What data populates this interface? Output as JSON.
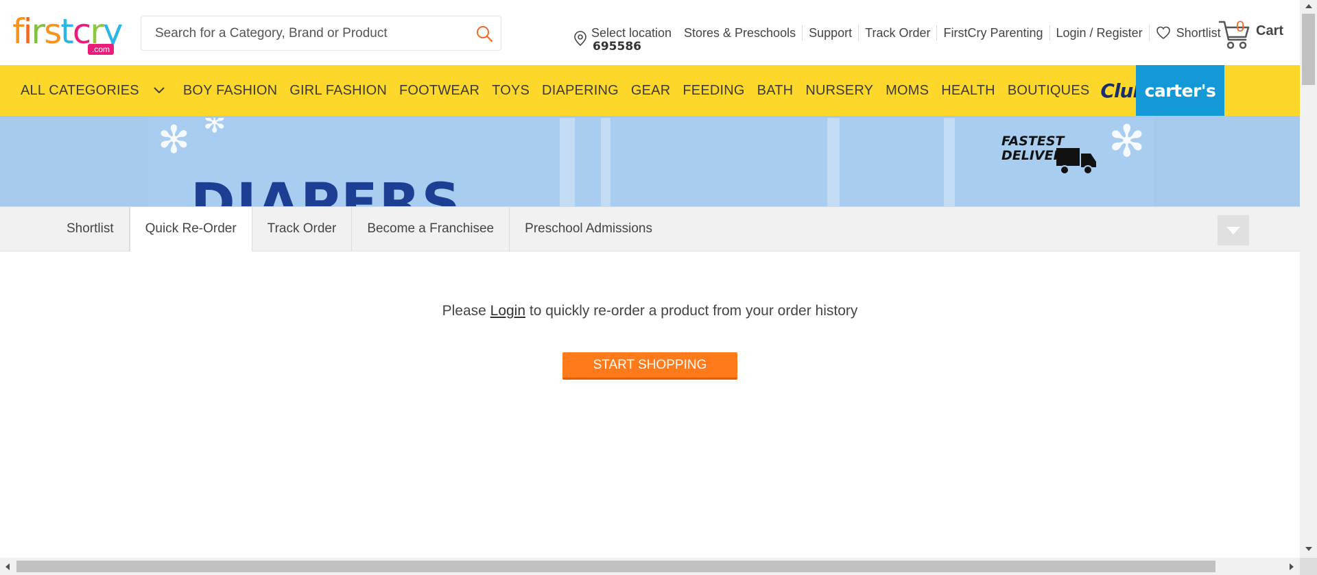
{
  "header": {
    "logo_text": "firstcry",
    "logo_com": ".com",
    "search_placeholder": "Search for a Category, Brand or Product",
    "location": {
      "label": "Select location",
      "pincode": "695586"
    },
    "links": [
      "Stores & Preschools",
      "Support",
      "Track Order",
      "FirstCry Parenting",
      "Login / Register"
    ],
    "shortlist_label": "Shortlist",
    "cart": {
      "count": "0",
      "label": "Cart"
    }
  },
  "nav": {
    "all_categories": "ALL CATEGORIES",
    "items": [
      "BOY FASHION",
      "GIRL FASHION",
      "FOOTWEAR",
      "TOYS",
      "DIAPERING",
      "GEAR",
      "FEEDING",
      "BATH",
      "NURSERY",
      "MOMS",
      "HEALTH",
      "BOUTIQUES"
    ],
    "club": "Club",
    "carters": "carter's"
  },
  "banner": {
    "title": "DIAPERS",
    "delivery_line1": "FASTEST",
    "delivery_line2": "DELIVERY",
    "colors": {
      "background": "#a9cdf0",
      "title": "#1c3f94"
    }
  },
  "tabs": {
    "items": [
      "Shortlist",
      "Quick Re-Order",
      "Track Order",
      "Become a Franchisee",
      "Preschool Admissions"
    ],
    "active": "Quick Re-Order"
  },
  "content": {
    "message_before": "Please ",
    "login_link": "Login",
    "message_after": " to quickly re-order a product from your order history",
    "button": "START SHOPPING"
  },
  "colors": {
    "nav_bg": "#fdd82a",
    "carters_bg": "#1399d6",
    "button_bg": "#ff7a1a",
    "cart_count": "#f26722"
  }
}
